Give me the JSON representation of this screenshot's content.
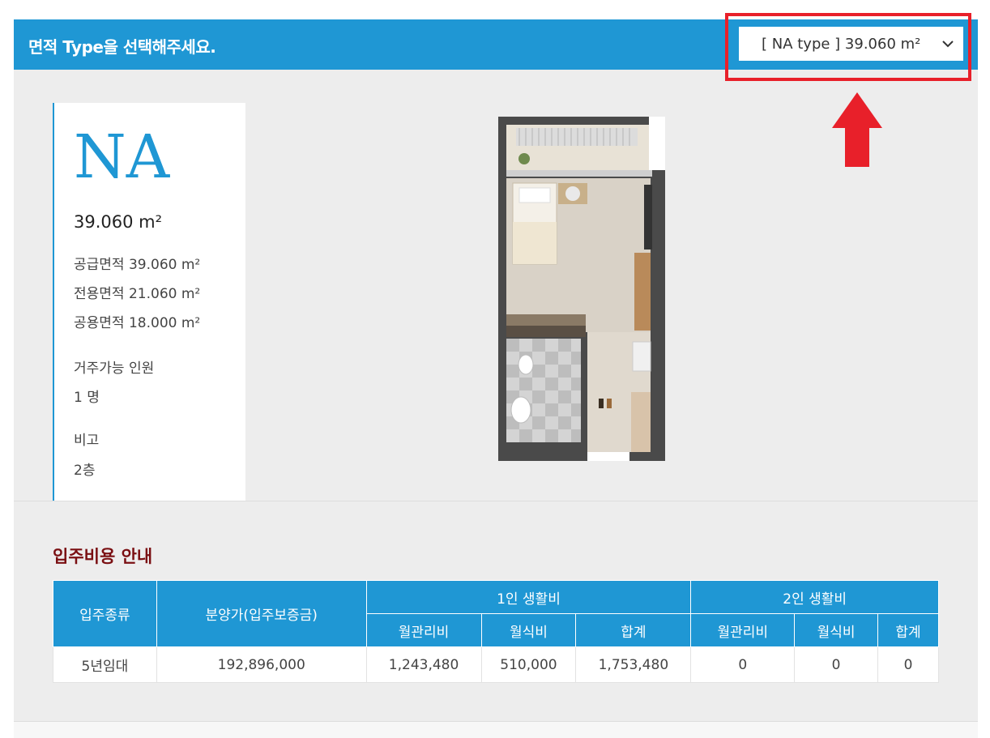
{
  "header": {
    "title": "면적 Type을 선택해주세요.",
    "selected_type": "[ NA type ] 39.060 m²"
  },
  "unit": {
    "code": "NA",
    "area": "39.060 m²",
    "supply_area": "공급면적 39.060 m²",
    "exclusive_area": "전용면적 21.060 m²",
    "common_area": "공용면적 18.000 m²",
    "capacity_label": "거주가능 인원",
    "capacity_value": "1 명",
    "note_label": "비고",
    "note_value": "2층"
  },
  "cost_section": {
    "title": "입주비용 안내",
    "headers": {
      "type": "입주종류",
      "price": "분양가(입주보증금)",
      "one_person": "1인 생활비",
      "two_person": "2인 생활비",
      "mgmt_fee": "월관리비",
      "meal_fee": "월식비",
      "total": "합계"
    },
    "rows": [
      [
        "5년임대",
        "192,896,000",
        "1,243,480",
        "510,000",
        "1,753,480",
        "0",
        "0",
        "0"
      ]
    ]
  },
  "colors": {
    "accent": "#1f97d4",
    "highlight": "#e8202a",
    "section_title": "#7a0f12"
  },
  "icons": {
    "dropdown": "chevron-down-icon",
    "pointer": "arrow-up-icon"
  }
}
